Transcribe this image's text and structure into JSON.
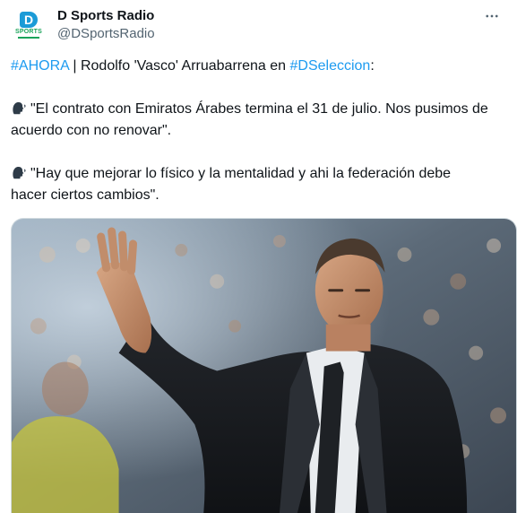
{
  "author": {
    "display_name": "D Sports Radio",
    "handle": "@DSportsRadio",
    "avatar_letter": "D",
    "avatar_word": "SPORTS"
  },
  "tweet": {
    "line1": {
      "hashtag1": "#AHORA",
      "middle": " | Rodolfo 'Vasco' Arruabarrena en ",
      "hashtag2": "#DSeleccion",
      "end": ":"
    },
    "quote1_line1": "\"El contrato con Emiratos Árabes termina el 31 de julio. Nos pusimos de",
    "quote1_line2": "acuerdo con no renovar\".",
    "quote2_line1": "\"Hay que mejorar lo físico y la mentalidad y ahi la federación debe",
    "quote2_line2": "hacer ciertos cambios\"."
  },
  "icons": {
    "speaking_head": "speaking-head-icon",
    "more": "more-options-icon"
  },
  "colors": {
    "accent": "#1d9bf0",
    "text": "#0f1419",
    "secondary": "#536471"
  }
}
